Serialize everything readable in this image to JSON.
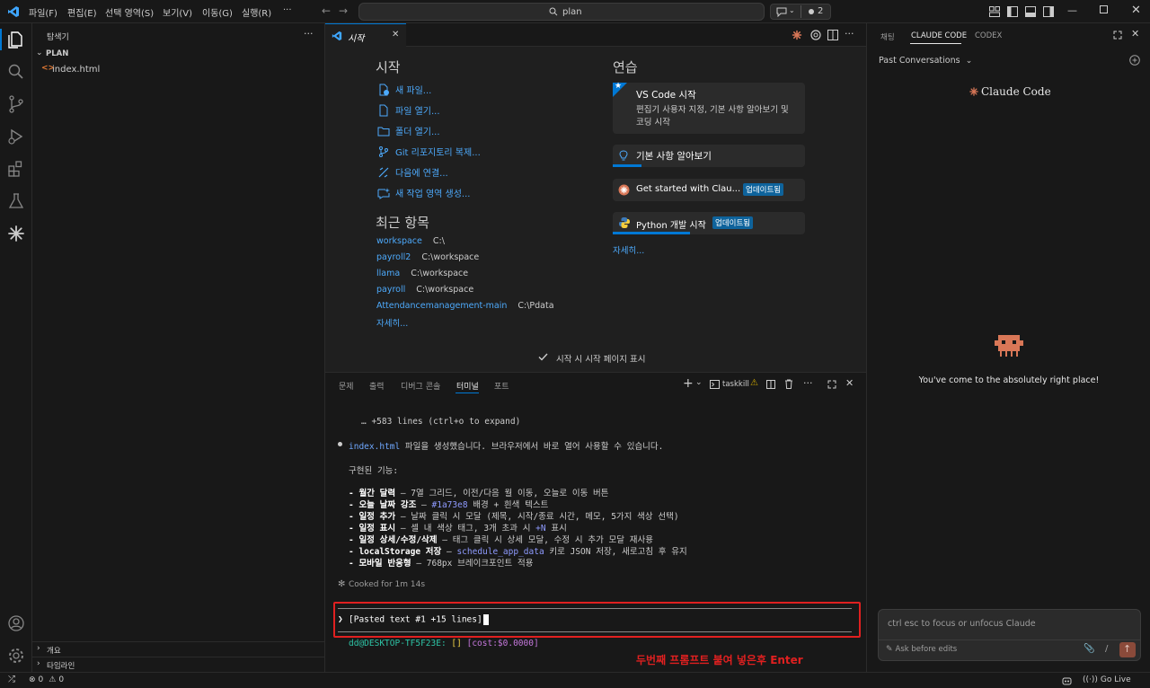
{
  "menu": {
    "items": [
      "파일(F)",
      "편집(E)",
      "선택 영역(S)",
      "보기(V)",
      "이동(G)",
      "실행(R)"
    ],
    "more": "···"
  },
  "command_center": {
    "text": "plan",
    "badge_count": "2"
  },
  "sidebar": {
    "title": "탐색기",
    "folder": "PLAN",
    "files": [
      "index.html"
    ],
    "outline": "개요",
    "timeline": "타임라인"
  },
  "editor": {
    "tab_label": "시작",
    "start": {
      "heading": "시작",
      "actions": [
        "새 파일...",
        "파일 열기...",
        "폴더 열기...",
        "Git 리포지토리 복제...",
        "다음에 연결...",
        "새 작업 영역 생성..."
      ]
    },
    "recent": {
      "heading": "최근 항목",
      "items": [
        {
          "name": "workspace",
          "path": "C:\\"
        },
        {
          "name": "payroll2",
          "path": "C:\\workspace"
        },
        {
          "name": "llama",
          "path": "C:\\workspace"
        },
        {
          "name": "payroll",
          "path": "C:\\workspace"
        },
        {
          "name": "Attendancemanagement-main",
          "path": "C:\\Pdata"
        }
      ],
      "more": "자세히..."
    },
    "walkthroughs": {
      "heading": "연습",
      "featured_title": "VS Code 시작",
      "featured_desc_1": "편집기 사용자 지정, 기본 사항 알아보기 및",
      "featured_desc_2": "코딩 시작",
      "basics": "기본 사항 알아보기",
      "basics_progress": 0.15,
      "claude": "Get started with Clau...",
      "claude_badge": "업데이트됨",
      "python": "Python 개발 시작",
      "python_badge": "업데이트됨",
      "python_progress": 0.4,
      "more": "자세히..."
    },
    "show_on_startup": "시작 시 시작 페이지 표시"
  },
  "panel": {
    "tabs": [
      "문제",
      "출력",
      "디버그 콘솔",
      "터미널",
      "포트"
    ],
    "active_tab": "터미널",
    "terminal_name": "taskkill"
  },
  "terminal": {
    "expand_line": "… +583 lines (ctrl+o to expand)",
    "file_name": "index.html",
    "file_msg": " 파일을 생성했습니다. 브라우저에서 바로 열어 사용할 수 있습니다.",
    "features_heading": "구현된 기능:",
    "f1_bold": "- 월간 달력",
    "f1_rest": " — 7열 그리드, 이전/다음 월 이동, 오늘로 이동 버튼",
    "f2_bold": "- 오늘 날짜 강조",
    "f2_mid": " — ",
    "f2_code": "#1a73e8",
    "f2_rest": " 배경 + 흰색 텍스트",
    "f3_bold": "- 일정 추가",
    "f3_rest": " — 날짜 클릭 시 모달 (제목, 시작/종료 시간, 메모, 5가지 색상 선택)",
    "f4_bold": "- 일정 표시",
    "f4_mid": " — 셀 내 색상 태그, 3개 초과 시 ",
    "f4_code": "+N",
    "f4_rest": " 표시",
    "f5_bold": "- 일정 상세/수정/삭제",
    "f5_rest": " — 태그 클릭 시 상세 모달, 수정 시 추가 모달 재사용",
    "f6_bold": "- localStorage 저장",
    "f6_mid": " — ",
    "f6_code": "schedule_app_data",
    "f6_rest": " 키로 JSON 저장, 새로고침 후 유지",
    "f7_bold": "- 모바일 반응형",
    "f7_rest": " — 768px 브레이크포인트 적용",
    "cooked": "Cooked for 1m 14s",
    "input": "[Pasted text #1 +15 lines]",
    "prompt_user": "dd@DESKTOP-TF5F23E:",
    "prompt_brackets": "[]",
    "prompt_cost": "[cost:$0.0000]",
    "annotation": "두번째 프롬프트 붙여 넣은후 Enter"
  },
  "right_panel": {
    "tabs": [
      "채팅",
      "CLAUDE CODE",
      "CODEX"
    ],
    "active_tab": "CLAUDE CODE",
    "past_conversations": "Past Conversations",
    "logo_text": "Claude Code",
    "welcome": "You've come to the absolutely right place!",
    "input_placeholder": "ctrl esc to focus or unfocus Claude",
    "ask_before_edits": "Ask before edits",
    "slash": "/"
  },
  "status": {
    "errors": "0",
    "warnings": "0",
    "go_live": "Go Live"
  },
  "colors": {
    "accent": "#0078d4",
    "link": "#4daafc",
    "claude": "#d97757",
    "annotation": "#e02020"
  }
}
